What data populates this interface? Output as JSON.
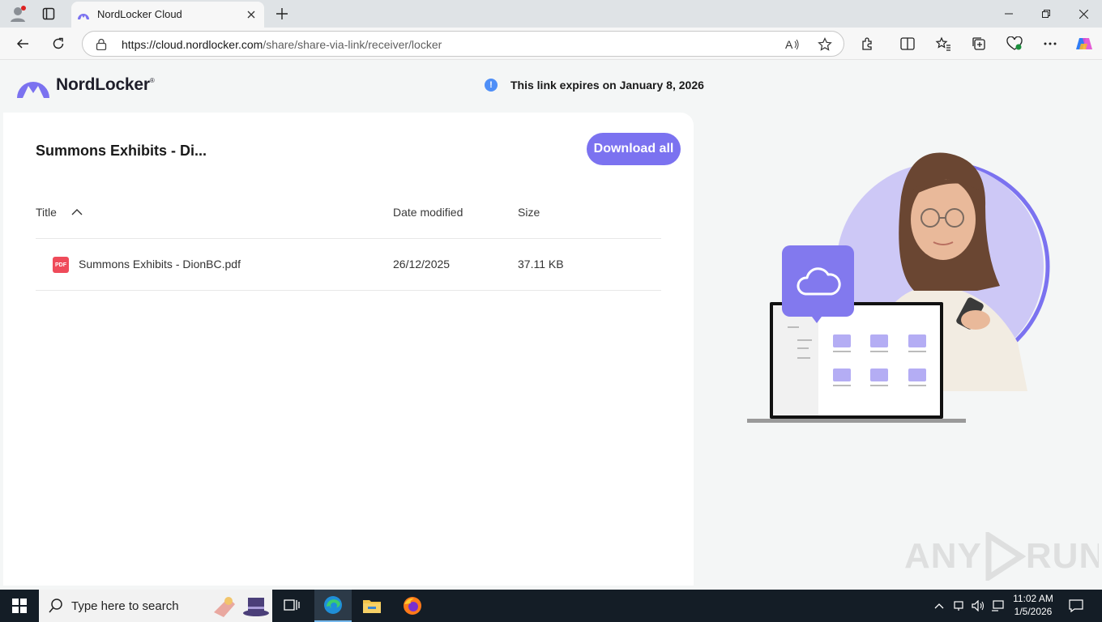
{
  "browser": {
    "tab_title": "NordLocker Cloud",
    "url_host": "https://cloud.nordlocker.com",
    "url_path": "/share/share-via-link/receiver/locker"
  },
  "header": {
    "logo_text": "NordLocker",
    "logo_mark": "®",
    "expiry_notice": "This link expires on January 8, 2026"
  },
  "share": {
    "title": "Summons Exhibits - Di...",
    "download_all_label": "Download all",
    "columns": {
      "title": "Title",
      "date_modified": "Date modified",
      "size": "Size"
    },
    "files": [
      {
        "icon_text": "PDF",
        "name": "Summons Exhibits - DionBC.pdf",
        "date_modified": "26/12/2025",
        "size": "37.11 KB"
      }
    ]
  },
  "watermark": {
    "text_left": "ANY",
    "text_right": "RUN"
  },
  "taskbar": {
    "search_placeholder": "Type here to search",
    "time": "11:02 AM",
    "date": "1/5/2026"
  },
  "colors": {
    "accent": "#7b72f0",
    "info": "#4f8ff7",
    "pdf": "#ef4b5a"
  }
}
